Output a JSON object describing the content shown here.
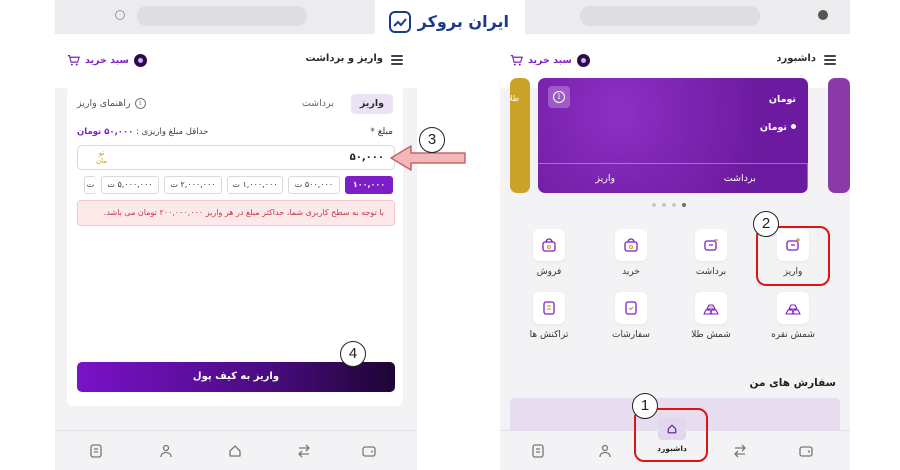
{
  "brand": {
    "logo_text": "ایران بروکر"
  },
  "left_screen": {
    "header": {
      "title": "واریز و برداشت",
      "cart_label": "سبد خرید"
    },
    "tabs": [
      {
        "label": "واریز",
        "active": true
      },
      {
        "label": "برداشت",
        "active": false
      }
    ],
    "guide_label": "راهنمای واریز",
    "amount_label": "مبلغ *",
    "min_amount_label": "حداقل مبلغ واریزی :",
    "min_amount_value": "۵۰,۰۰۰ تومان",
    "amount_value": "۵۰,۰۰۰",
    "amount_unit_line1": "تو",
    "amount_unit_line2": "مان",
    "quick_amounts": [
      {
        "label": "۱۰۰,۰۰۰",
        "active": true
      },
      {
        "label": "۵۰۰,۰۰۰ ت",
        "active": false
      },
      {
        "label": "۱,۰۰۰,۰۰۰ ت",
        "active": false
      },
      {
        "label": "۲,۰۰۰,۰۰۰ ت",
        "active": false
      },
      {
        "label": "۵,۰۰۰,۰۰۰ ت",
        "active": false
      },
      {
        "label": "ت",
        "active": false
      }
    ],
    "warning_text": "با توجه به سطح کاربری شما، حداکثر مبلغ در هر واریز ۲۰۰,۰۰۰,۰۰۰ تومان می باشد.",
    "submit_label": "واریز به کیف پول"
  },
  "right_screen": {
    "header": {
      "title": "داشبورد",
      "cart_label": "سبد خرید"
    },
    "wallet_card": {
      "currency_title": "تومان",
      "currency_item": "تومان",
      "deposit_label": "واریز",
      "withdraw_label": "برداشت"
    },
    "peek_card_text": "طلا",
    "actions_row1": [
      {
        "label": "واریز",
        "icon": "wallet-deposit-icon"
      },
      {
        "label": "برداشت",
        "icon": "wallet-withdraw-icon"
      },
      {
        "label": "خرید",
        "icon": "bag-buy-icon"
      },
      {
        "label": "فروش",
        "icon": "bag-sell-icon"
      }
    ],
    "actions_row2": [
      {
        "label": "شمش نقره",
        "icon": "silver-bar-icon"
      },
      {
        "label": "شمش طلا",
        "icon": "gold-bar-icon"
      },
      {
        "label": "سفارشات",
        "icon": "orders-icon"
      },
      {
        "label": "تراکنش ها",
        "icon": "transactions-icon"
      }
    ],
    "section_title": "سفارش های من",
    "bottom_nav_active_label": "داشبورد"
  },
  "annotations": {
    "badge1": "1",
    "badge2": "2",
    "badge3": "3",
    "badge4": "4"
  },
  "colors": {
    "accent": "#7c1fc7",
    "wallet": "#7a1fb0",
    "highlight": "#e01212",
    "warning_bg": "#fde8ea"
  }
}
